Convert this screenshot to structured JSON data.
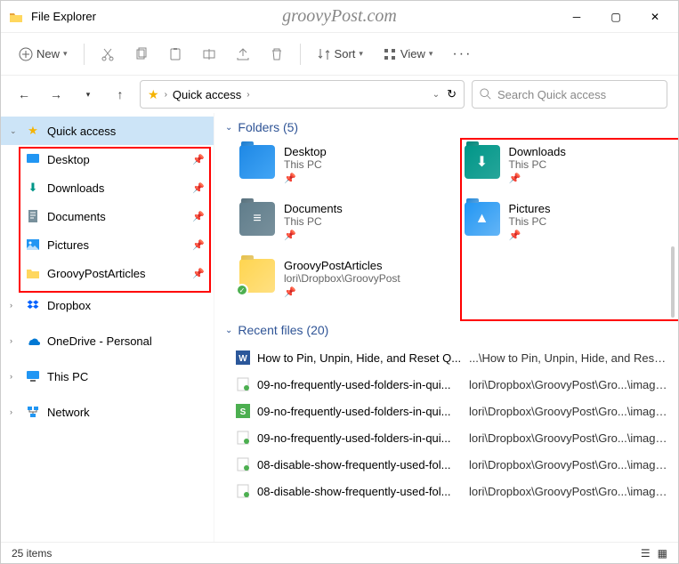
{
  "window": {
    "title": "File Explorer",
    "watermark": "groovyPost.com"
  },
  "toolbar": {
    "new": "New",
    "sort": "Sort",
    "view": "View"
  },
  "breadcrumb": {
    "label": "Quick access"
  },
  "search": {
    "placeholder": "Search Quick access"
  },
  "sidebar": {
    "quick": "Quick access",
    "items": [
      "Desktop",
      "Downloads",
      "Documents",
      "Pictures",
      "GroovyPostArticles"
    ],
    "lower": [
      "Dropbox",
      "OneDrive - Personal",
      "This PC",
      "Network"
    ]
  },
  "sections": {
    "folders": "Folders (5)",
    "recent": "Recent files (20)"
  },
  "folders": [
    {
      "name": "Desktop",
      "sub": "This PC",
      "kind": "desktop"
    },
    {
      "name": "Downloads",
      "sub": "This PC",
      "kind": "downloads"
    },
    {
      "name": "Documents",
      "sub": "This PC",
      "kind": "documents"
    },
    {
      "name": "Pictures",
      "sub": "This PC",
      "kind": "pictures"
    },
    {
      "name": "GroovyPostArticles",
      "sub": "lori\\Dropbox\\GroovyPost",
      "kind": "generic",
      "check": true
    }
  ],
  "recent": [
    {
      "name": "How to Pin, Unpin, Hide, and Reset Q...",
      "path": "...\\How to Pin, Unpin, Hide, and Reset ...",
      "type": "word"
    },
    {
      "name": "09-no-frequently-used-folders-in-qui...",
      "path": "lori\\Dropbox\\GroovyPost\\Gro...\\images",
      "type": "img"
    },
    {
      "name": "09-no-frequently-used-folders-in-qui...",
      "path": "lori\\Dropbox\\GroovyPost\\Gro...\\images",
      "type": "snag"
    },
    {
      "name": "09-no-frequently-used-folders-in-qui...",
      "path": "lori\\Dropbox\\GroovyPost\\Gro...\\images",
      "type": "img"
    },
    {
      "name": "08-disable-show-frequently-used-fol...",
      "path": "lori\\Dropbox\\GroovyPost\\Gro...\\images",
      "type": "img"
    },
    {
      "name": "08-disable-show-frequently-used-fol...",
      "path": "lori\\Dropbox\\GroovyPost\\Gro...\\images",
      "type": "img"
    }
  ],
  "status": {
    "count": "25 items"
  }
}
